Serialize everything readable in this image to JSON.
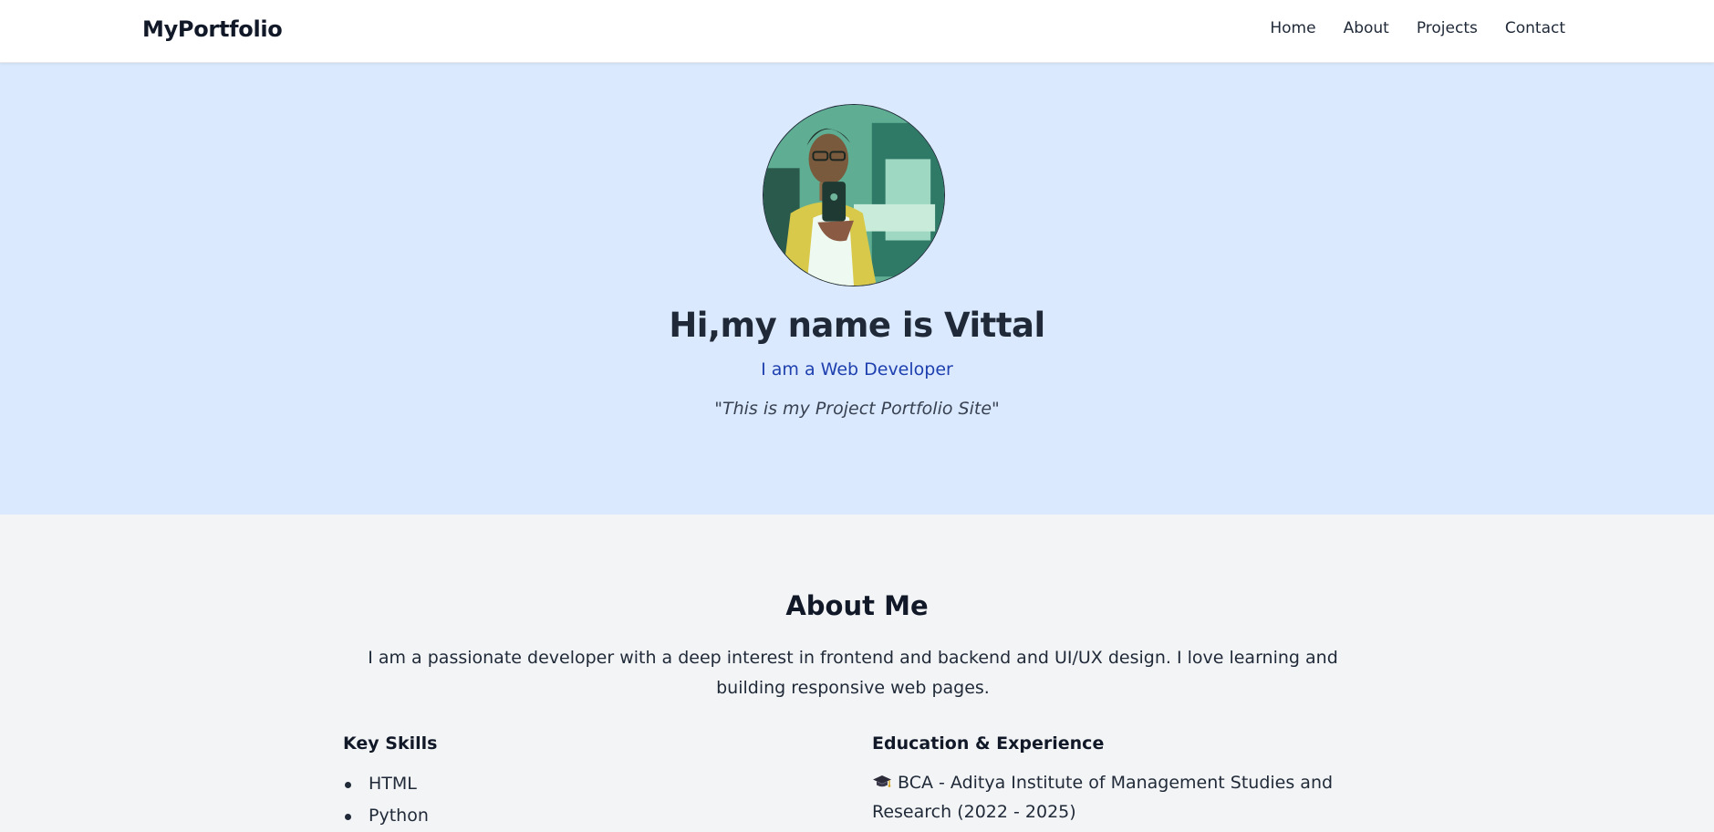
{
  "nav": {
    "brand": "MyPortfolio",
    "links": [
      "Home",
      "About",
      "Projects",
      "Contact"
    ]
  },
  "hero": {
    "title": "Hi,my name is Vittal",
    "subtitle": "I am a Web Developer",
    "quote": "\"This is my Project Portfolio Site\""
  },
  "about": {
    "title": "About Me",
    "intro": "I am a passionate developer with a deep interest in frontend and backend and UI/UX design. I love learning and building responsive web pages.",
    "skills": {
      "title": "Key Skills",
      "items": [
        "HTML",
        "Python"
      ]
    },
    "education": {
      "title": "Education & Experience",
      "icon": "graduation-cap-icon",
      "items": [
        "BCA - Aditya Institute of Management Studies and Research (2022 - 2025)"
      ]
    }
  },
  "colors": {
    "hero_bg": "#dbe9fe",
    "accent": "#1e40af",
    "text": "#1f2937",
    "page_bg": "#f3f4f6"
  }
}
